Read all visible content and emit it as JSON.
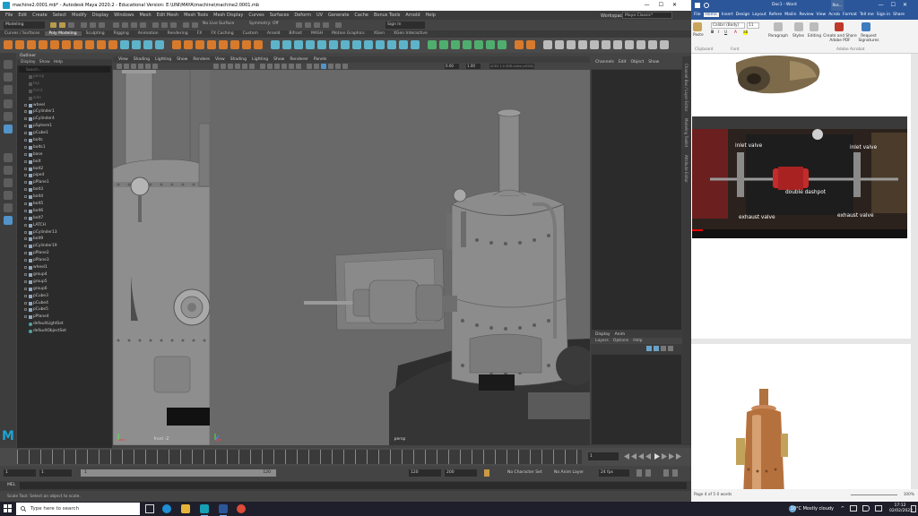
{
  "maya": {
    "title": "machine2.0001.mb* - Autodesk Maya 2020.2 - Educational Version: E:\\UNI\\MAYA\\machine\\machine2.0001.mb",
    "menu": [
      "File",
      "Edit",
      "Create",
      "Select",
      "Modify",
      "Display",
      "Windows",
      "Mesh",
      "Edit Mesh",
      "Mesh Tools",
      "Mesh Display",
      "Curves",
      "Surfaces",
      "Deform",
      "UV",
      "Generate",
      "Cache",
      "Bonus Tools",
      "Arnold",
      "Help"
    ],
    "workspace_label": "Workspace :",
    "workspace_value": "Maya Classic*",
    "mode": "Modeling",
    "no_live_surface": "No Live Surface",
    "symmetry": "Symmetry: Off",
    "sign_in": "Sign In",
    "shelf_tabs": [
      "Curves / Surfaces",
      "Poly Modeling",
      "Sculpting",
      "Rigging",
      "Animation",
      "Rendering",
      "FX",
      "FX Caching",
      "Custom",
      "Arnold",
      "Bifrost",
      "MASH",
      "Motion Graphics",
      "XGen",
      "XGen Interactive"
    ],
    "shelf_active": "Poly Modeling",
    "outliner": {
      "title": "Outliner",
      "menu": [
        "Display",
        "Show",
        "Help"
      ],
      "search_placeholder": "Search...",
      "items": [
        {
          "name": "persp",
          "dim": true
        },
        {
          "name": "top",
          "dim": true
        },
        {
          "name": "front",
          "dim": true
        },
        {
          "name": "side",
          "dim": true
        },
        {
          "name": "wheel"
        },
        {
          "name": "pCylinder1"
        },
        {
          "name": "pCylinder4"
        },
        {
          "name": "pSphere1"
        },
        {
          "name": "pCube1"
        },
        {
          "name": "bolts"
        },
        {
          "name": "bolts1"
        },
        {
          "name": "base"
        },
        {
          "name": "bolt"
        },
        {
          "name": "bolt2"
        },
        {
          "name": "pipe4"
        },
        {
          "name": "pPlane1"
        },
        {
          "name": "bolt3"
        },
        {
          "name": "bolt4"
        },
        {
          "name": "bolt5"
        },
        {
          "name": "bolt6"
        },
        {
          "name": "bolt7"
        },
        {
          "name": "LATCH"
        },
        {
          "name": "pCylinder13"
        },
        {
          "name": "bolt9"
        },
        {
          "name": "pCylinder19"
        },
        {
          "name": "pPlane2"
        },
        {
          "name": "pPlane3"
        },
        {
          "name": "wheel1"
        },
        {
          "name": "group4"
        },
        {
          "name": "group5"
        },
        {
          "name": "group6"
        },
        {
          "name": "pCube3"
        },
        {
          "name": "pCube4"
        },
        {
          "name": "pCube5"
        },
        {
          "name": "pPlane4"
        },
        {
          "name": "defaultLightSet",
          "set": true
        },
        {
          "name": "defaultObjectSet",
          "set": true
        }
      ]
    },
    "viewport_menu": [
      "View",
      "Shading",
      "Lighting",
      "Show",
      "Renderer",
      "Panels"
    ],
    "viewport_front_label": "front -Z",
    "viewport_persp_label": "persp",
    "persp_fields": [
      "0.00",
      "1.00"
    ],
    "persp_color_space": "ACES 1.0 SDR-video (sRGB)",
    "channel_box_menu": [
      "Channels",
      "Edit",
      "Object",
      "Show"
    ],
    "layers_tabs": [
      "Display",
      "Anim"
    ],
    "layers_menu": [
      "Layers",
      "Options",
      "Help"
    ],
    "side_tabs": [
      "Channel Box / Layer Editor",
      "Modeling Toolkit",
      "Attribute Editor"
    ],
    "timeslider_current": "1",
    "range": {
      "start": "1",
      "inner_start": "1",
      "bar_label": "1",
      "inner_end": "120",
      "end1": "120",
      "end2": "200"
    },
    "no_character_set": "No Character Set",
    "no_anim_layer": "No Anim Layer",
    "fps": "24 fps",
    "mel": "MEL",
    "help_line": "Scale Tool: Select an object to scale."
  },
  "word": {
    "title": "Doc1 - Word",
    "restore_label": "Ros...",
    "tabs": [
      "File",
      "Home",
      "Insert",
      "Design",
      "Layout",
      "Refere",
      "Mailin",
      "Review",
      "View",
      "Acrob",
      "Format",
      "Tell me",
      "Sign in",
      "Share"
    ],
    "active_tab": "Home",
    "font": "Calibri (Body)",
    "font_size": "11",
    "ribbon_buttons": [
      "Paragraph",
      "Styles",
      "Editing",
      "Create and Share Adobe PDF",
      "Request Signatures"
    ],
    "ribbon_groups": [
      "Clipboard",
      "Font",
      "Adobe Acrobat"
    ],
    "paste_label": "Paste",
    "video_labels": [
      "inlet valve",
      "inlet valve",
      "double dashpot",
      "exhaust valve",
      "exhaust valve"
    ],
    "status": "Page 4 of 5   0 words",
    "zoom": "100%"
  },
  "taskbar": {
    "search_placeholder": "Type here to search",
    "weather": "10°C  Mostly cloudy",
    "time": "17:12",
    "date": "02/02/2022"
  }
}
